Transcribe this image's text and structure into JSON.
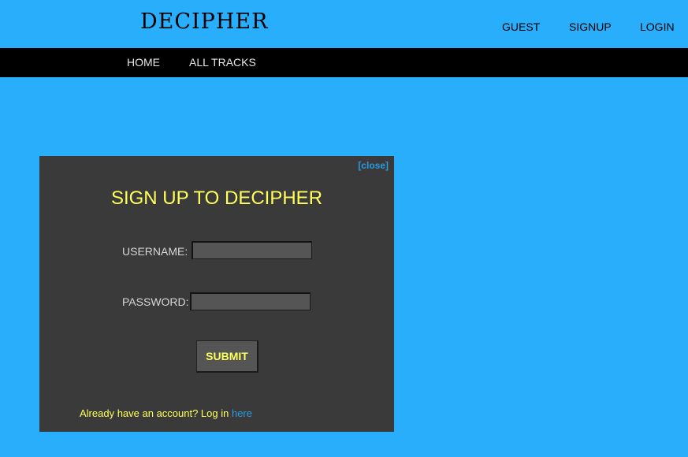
{
  "header": {
    "logo": "DECIPHER",
    "links": {
      "guest": "GUEST",
      "signup": "SIGNUP",
      "login": "LOGIN"
    }
  },
  "navbar": {
    "home": "HOME",
    "all_tracks": "ALL TRACKS"
  },
  "modal": {
    "close_label": "[close]",
    "title": "SIGN UP TO DECIPHER",
    "username_label": "USERNAME:",
    "username_value": "",
    "password_label": "PASSWORD:",
    "password_value": "",
    "submit_label": "SUBMIT",
    "footer_text": "Already have an account? Log in ",
    "footer_link": "here"
  },
  "colors": {
    "background": "#29aefb",
    "navbar": "#000000",
    "modal_bg": "#3a3a3a",
    "accent_yellow": "#ffff5c",
    "link_blue": "#2a9be0"
  }
}
